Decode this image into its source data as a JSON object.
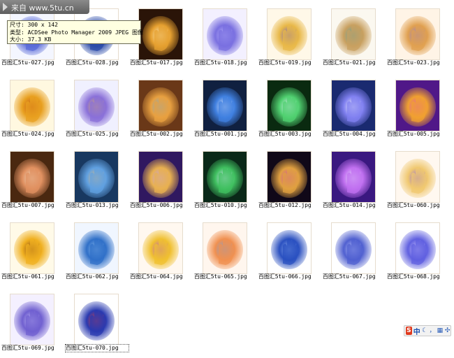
{
  "watermark": {
    "text": "来自 www.5tu.cn"
  },
  "tooltip": {
    "lines": [
      "尺寸: 300 x 142",
      "类型: ACDSee Photo Manager 2009 JPEG 图像",
      "大小: 37.3 KB"
    ]
  },
  "files": [
    {
      "name": "百图汇5tu-027.jpg",
      "colors": [
        "#f4f6ff",
        "#5a6bd8",
        "#d8b070"
      ]
    },
    {
      "name": "百图汇5tu-028.jpg",
      "colors": [
        "#ffffff",
        "#2a4aa8",
        "#a8c8ff"
      ]
    },
    {
      "name": "百图汇5tu-017.jpg",
      "colors": [
        "#2a1408",
        "#e6a030",
        "#fff2c8"
      ]
    },
    {
      "name": "百图汇5tu-018.jpg",
      "colors": [
        "#f3f0ff",
        "#7a70e0",
        "#c0b8ff"
      ]
    },
    {
      "name": "百图汇5tu-019.jpg",
      "colors": [
        "#fff8e8",
        "#e8b848",
        "#6a58c8"
      ]
    },
    {
      "name": "百图汇5tu-021.jpg",
      "colors": [
        "#fbf8f0",
        "#c8a060",
        "#58a0a0"
      ]
    },
    {
      "name": "百图汇5tu-023.jpg",
      "colors": [
        "#fff4e6",
        "#e0a050",
        "#8878d8"
      ]
    },
    {
      "name": "百图汇5tu-024.jpg",
      "colors": [
        "#fff8e0",
        "#e8a020",
        "#c05010"
      ]
    },
    {
      "name": "百图汇5tu-025.jpg",
      "colors": [
        "#f0f0ff",
        "#8a70d8",
        "#e0b060"
      ]
    },
    {
      "name": "百图汇5tu-002.jpg",
      "colors": [
        "#6a3818",
        "#e8a040",
        "#70b0e0"
      ]
    },
    {
      "name": "百图汇5tu-001.jpg",
      "colors": [
        "#102040",
        "#4080e0",
        "#f0f4ff"
      ]
    },
    {
      "name": "百图汇5tu-003.jpg",
      "colors": [
        "#0a2a10",
        "#50d070",
        "#e8f0ff"
      ]
    },
    {
      "name": "百图汇5tu-004.jpg",
      "colors": [
        "#1a2a70",
        "#8080f0",
        "#ffffff"
      ]
    },
    {
      "name": "百图汇5tu-005.jpg",
      "colors": [
        "#501888",
        "#f0a030",
        "#e050c0"
      ]
    },
    {
      "name": "百图汇5tu-007.jpg",
      "colors": [
        "#4a2810",
        "#e09060",
        "#f0e0c8"
      ]
    },
    {
      "name": "百图汇5tu-013.jpg",
      "colors": [
        "#183860",
        "#60a0e0",
        "#e8c080"
      ]
    },
    {
      "name": "百图汇5tu-006.jpg",
      "colors": [
        "#301860",
        "#e8b050",
        "#c0a0ff"
      ]
    },
    {
      "name": "百图汇5tu-010.jpg",
      "colors": [
        "#0a2818",
        "#40c060",
        "#e0e8ff"
      ]
    },
    {
      "name": "百图汇5tu-012.jpg",
      "colors": [
        "#100818",
        "#e0a040",
        "#d048b0"
      ]
    },
    {
      "name": "百图汇5tu-014.jpg",
      "colors": [
        "#3a1880",
        "#c070f0",
        "#f0e8ff"
      ]
    },
    {
      "name": "百图汇5tu-060.jpg",
      "colors": [
        "#fff8f0",
        "#f0c870",
        "#8860e0"
      ]
    },
    {
      "name": "百图汇5tu-061.jpg",
      "colors": [
        "#fffae8",
        "#f0b020",
        "#804010"
      ]
    },
    {
      "name": "百图汇5tu-062.jpg",
      "colors": [
        "#f0f6ff",
        "#3070c8",
        "#90c0f0"
      ]
    },
    {
      "name": "百图汇5tu-064.jpg",
      "colors": [
        "#fff8f0",
        "#f0c030",
        "#b050d0"
      ]
    },
    {
      "name": "百图汇5tu-065.jpg",
      "colors": [
        "#fff6ee",
        "#f09050",
        "#70a0e0"
      ]
    },
    {
      "name": "百图汇5tu-066.jpg",
      "colors": [
        "#ffffff",
        "#2a50c0",
        "#90b0f0"
      ]
    },
    {
      "name": "百图汇5tu-067.jpg",
      "colors": [
        "#ffffff",
        "#5060d0",
        "#c0c8ff"
      ]
    },
    {
      "name": "百图汇5tu-068.jpg",
      "colors": [
        "#ffffff",
        "#6060e0",
        "#d0c8ff"
      ]
    },
    {
      "name": "百图汇5tu-069.jpg",
      "colors": [
        "#f4f0ff",
        "#7060d0",
        "#c8c0f8"
      ]
    },
    {
      "name": "百图汇5tu-070.jpg",
      "colors": [
        "#ffffff",
        "#2a3ab0",
        "#e04040"
      ]
    }
  ],
  "selected_index": 29,
  "ime": {
    "logo": "S",
    "lang": "中",
    "moon_icon": "moon-icon",
    "punct": "，"
  }
}
